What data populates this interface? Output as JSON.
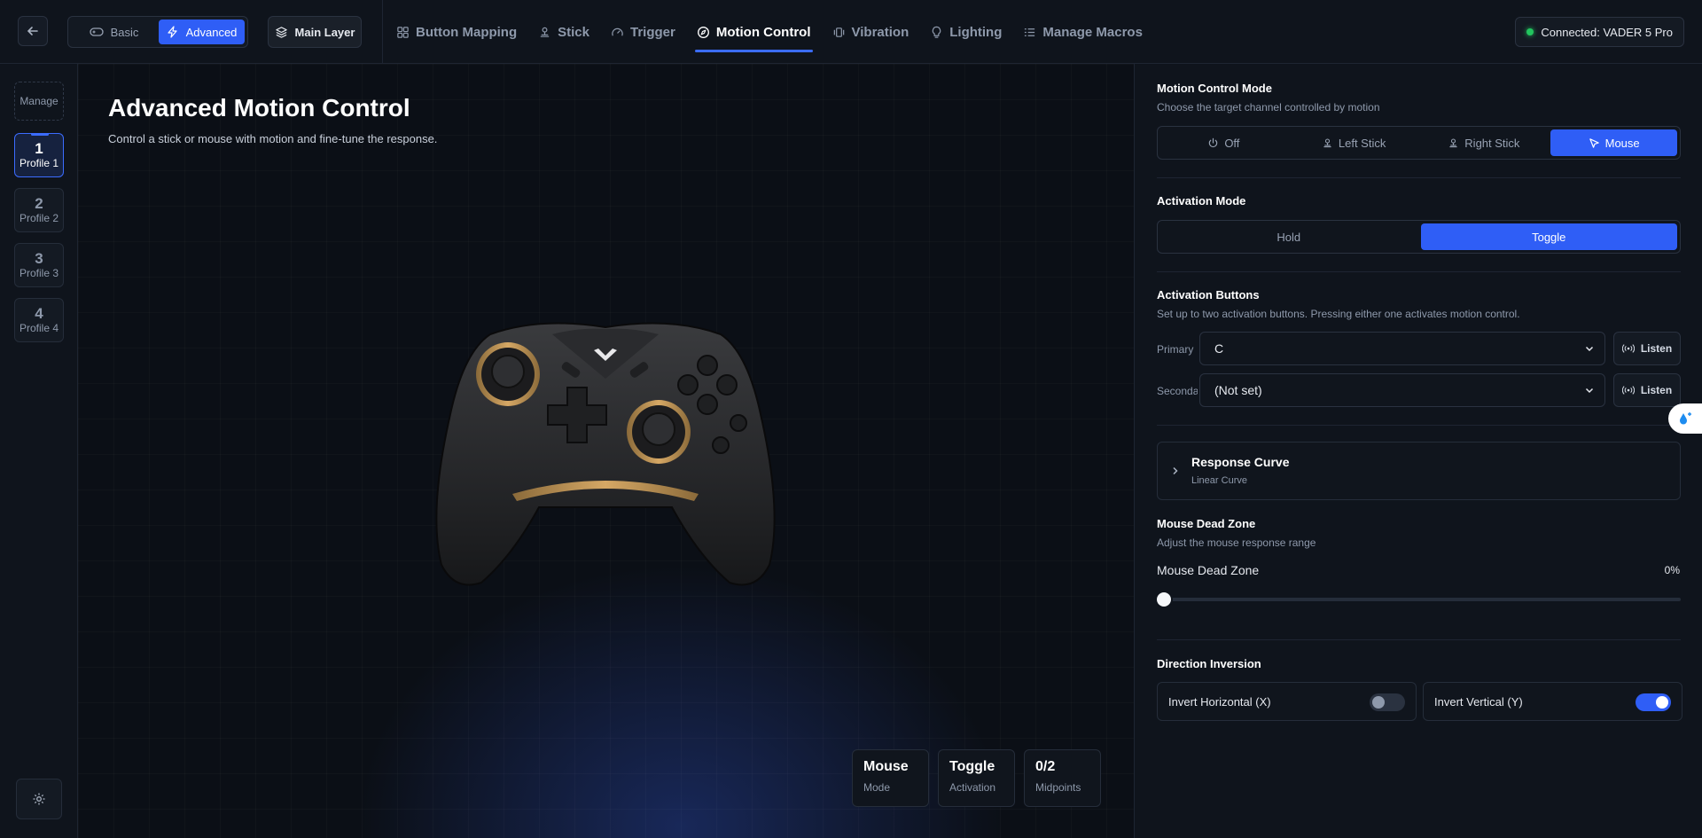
{
  "topbar": {
    "mode": {
      "basic": "Basic",
      "advanced": "Advanced",
      "selected": "Advanced"
    },
    "layer_label": "Main Layer",
    "nav": [
      {
        "label": "Button Mapping",
        "icon": "grid-icon"
      },
      {
        "label": "Stick",
        "icon": "joystick-icon"
      },
      {
        "label": "Trigger",
        "icon": "gauge-icon"
      },
      {
        "label": "Motion Control",
        "icon": "compass-icon",
        "active": true
      },
      {
        "label": "Vibration",
        "icon": "vibration-icon"
      },
      {
        "label": "Lighting",
        "icon": "bulb-icon"
      },
      {
        "label": "Manage Macros",
        "icon": "list-icon"
      }
    ],
    "connection": "Connected: VADER 5 Pro"
  },
  "sidebar": {
    "manage_label": "Manage",
    "profiles": [
      {
        "num": "1",
        "label": "Profile 1",
        "active": true
      },
      {
        "num": "2",
        "label": "Profile 2"
      },
      {
        "num": "3",
        "label": "Profile 3"
      },
      {
        "num": "4",
        "label": "Profile 4"
      }
    ]
  },
  "main": {
    "title": "Advanced Motion Control",
    "subtitle": "Control a stick or mouse with motion and fine-tune the response.",
    "stats": [
      {
        "value": "Mouse",
        "label": "Mode"
      },
      {
        "value": "Toggle",
        "label": "Activation"
      },
      {
        "value": "0/2",
        "label": "Midpoints"
      }
    ]
  },
  "panel": {
    "motion_mode": {
      "title": "Motion Control Mode",
      "desc": "Choose the target channel controlled by motion",
      "options": [
        "Off",
        "Left Stick",
        "Right Stick",
        "Mouse"
      ],
      "selected": "Mouse"
    },
    "activation_mode": {
      "title": "Activation Mode",
      "options": [
        "Hold",
        "Toggle"
      ],
      "selected": "Toggle"
    },
    "activation_buttons": {
      "title": "Activation Buttons",
      "desc": "Set up to two activation buttons. Pressing either one activates motion control.",
      "primary_label": "Primary",
      "primary_value": "C",
      "secondary_label": "Secondary",
      "secondary_value": "(Not set)",
      "listen_label": "Listen"
    },
    "response_curve": {
      "title": "Response Curve",
      "value": "Linear Curve"
    },
    "dead_zone": {
      "title": "Mouse Dead Zone",
      "desc": "Adjust the mouse response range",
      "label": "Mouse Dead Zone",
      "value": "0%",
      "fraction": 0
    },
    "direction": {
      "title": "Direction Inversion",
      "invert_x_label": "Invert Horizontal (X)",
      "invert_x": false,
      "invert_y_label": "Invert Vertical (Y)",
      "invert_y": true
    }
  },
  "colors": {
    "accent": "#2f5ef6",
    "connected": "#22c55e",
    "bg": "#0d1118"
  }
}
